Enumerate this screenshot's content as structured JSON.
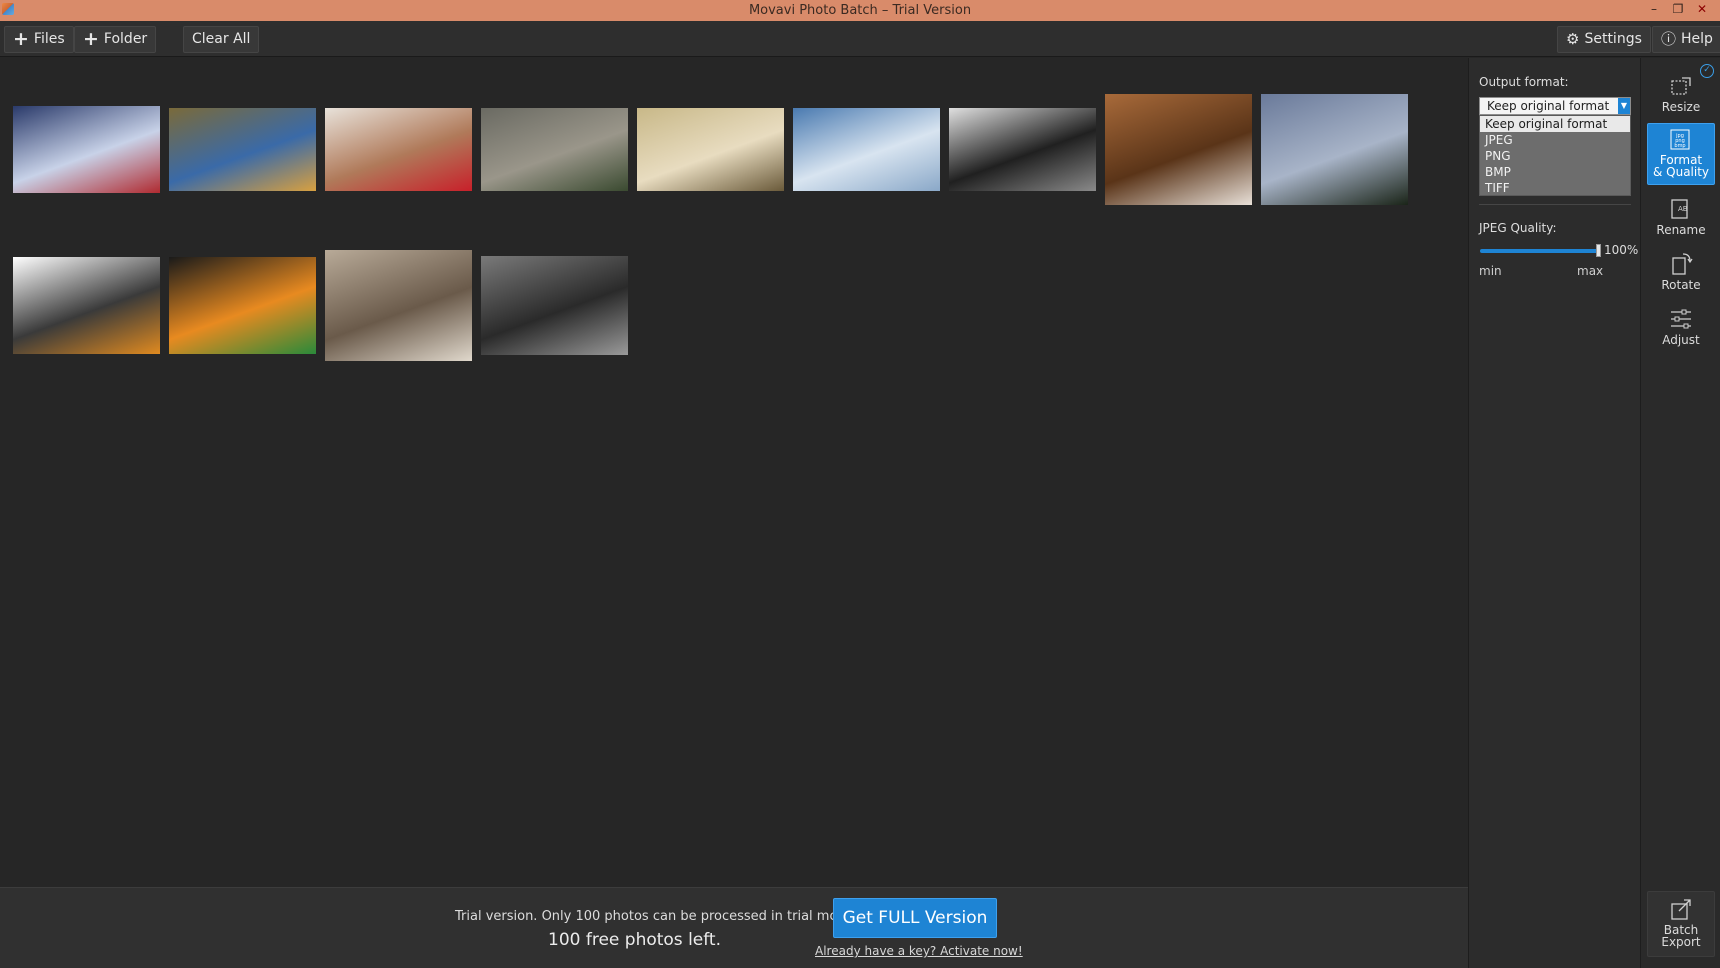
{
  "window": {
    "title": "Movavi Photo Batch – Trial Version",
    "controls": [
      "–",
      "❐",
      "✕"
    ]
  },
  "toolbar": {
    "files_label": "Files",
    "folder_label": "Folder",
    "clear_all_label": "Clear All",
    "settings_label": "Settings",
    "help_label": "Help"
  },
  "thumbnails": [
    {
      "name": "tv-screen",
      "colors": [
        "#2a3a6a",
        "#c8d2e8",
        "#b02a30"
      ]
    },
    {
      "name": "app-screen-palms",
      "colors": [
        "#7a6a3a",
        "#3a6aa8",
        "#d8a040"
      ]
    },
    {
      "name": "towel-animal",
      "colors": [
        "#e8e2da",
        "#b07a5a",
        "#c8202a"
      ]
    },
    {
      "name": "rocks",
      "colors": [
        "#6a6a62",
        "#9a968a",
        "#3a4a30"
      ]
    },
    {
      "name": "mall-interior",
      "colors": [
        "#c8b888",
        "#e8dcc0",
        "#6a5a3a"
      ]
    },
    {
      "name": "clouds-aerial",
      "colors": [
        "#4a7ab0",
        "#d8e4f0",
        "#8aa8c8"
      ]
    },
    {
      "name": "office-desk",
      "colors": [
        "#e0e0e0",
        "#202020",
        "#8a8a8a"
      ]
    },
    {
      "name": "drone-on-floor",
      "colors": [
        "#a86a3a",
        "#5a3418",
        "#e8e0d8"
      ]
    },
    {
      "name": "evening-sky",
      "colors": [
        "#6a7a9a",
        "#a8b4c8",
        "#1a2418"
      ]
    },
    {
      "name": "mug",
      "colors": [
        "#ffffff",
        "#3a3a3a",
        "#e08a20"
      ]
    },
    {
      "name": "smartphone",
      "colors": [
        "#1a1a1a",
        "#e88a20",
        "#2a8a3a"
      ]
    },
    {
      "name": "persian-cat",
      "colors": [
        "#b8aa98",
        "#6a5a4a",
        "#e0d8cc"
      ]
    },
    {
      "name": "ram-modules",
      "colors": [
        "#7a7a7a",
        "#2a2a2a",
        "#9a9a9a"
      ]
    }
  ],
  "bottom": {
    "trial_text": "Trial version. Only 100 photos can be processed in trial mode.",
    "free_left": "100 free photos left.",
    "get_full_label": "Get FULL Version",
    "activate_link": "Already have a key? Activate now!"
  },
  "panel": {
    "output_format_label": "Output format:",
    "selected_format": "Keep original format",
    "format_options": [
      "Keep original format",
      "JPEG",
      "PNG",
      "BMP",
      "TIFF"
    ],
    "jpeg_quality_label": "JPEG Quality:",
    "jpeg_quality_value": "100%",
    "jpeg_quality_fraction": 1.0,
    "min_label": "min",
    "max_label": "max"
  },
  "tools": {
    "resize_label": "Resize",
    "format_label_1": "Format",
    "format_label_2": "& Quality",
    "format_icon_text": "jpg png bmp",
    "rename_label": "Rename",
    "rotate_label": "Rotate",
    "adjust_label": "Adjust",
    "batch_label_1": "Batch",
    "batch_label_2": "Export"
  },
  "colors": {
    "accent": "#1e84d4",
    "titlebar": "#d98b6a",
    "background": "#262626"
  }
}
